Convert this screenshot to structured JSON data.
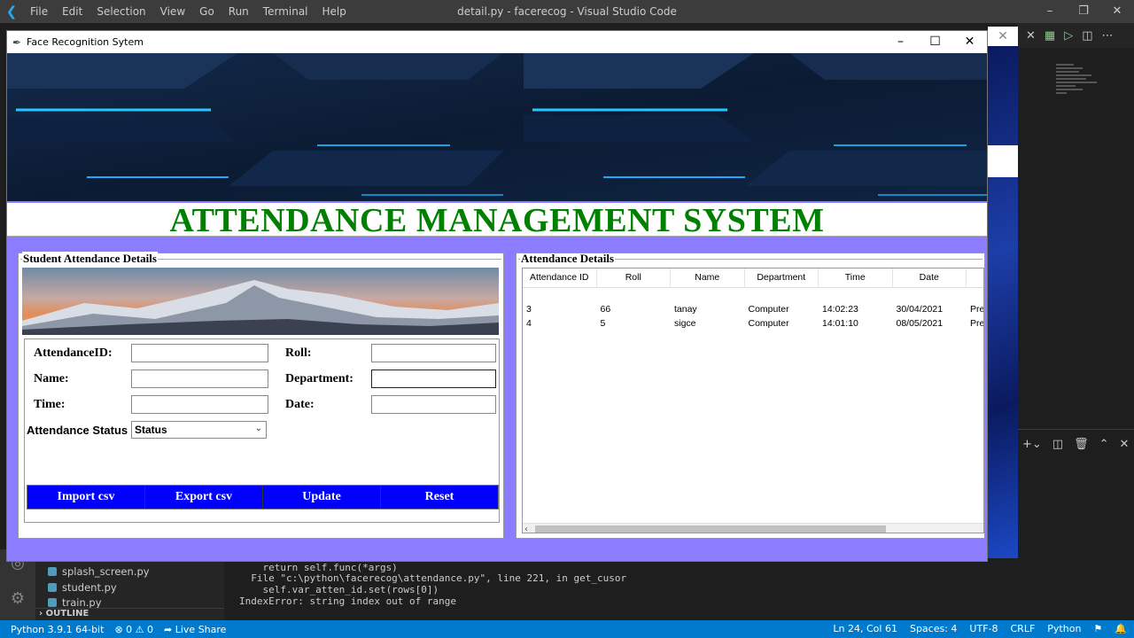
{
  "vscode": {
    "menu": [
      "File",
      "Edit",
      "Selection",
      "View",
      "Go",
      "Run",
      "Terminal",
      "Help"
    ],
    "title": "detail.py - facerecog - Visual Studio Code",
    "explorer_files": [
      "splash_screen.py",
      "student.py",
      "train.py"
    ],
    "outline_label": "OUTLINE",
    "terminal_lines": [
      "    return self.func(*args)",
      "  File \"c:\\python\\facerecog\\attendance.py\", line 221, in get_cusor",
      "    self.var_atten_id.set(rows[0])",
      "IndexError: string index out of range"
    ],
    "status_left": {
      "python": "Python 3.9.1 64-bit",
      "problems": "⊗ 0 ⚠ 0",
      "live_share": "Live Share"
    },
    "status_right": {
      "position": "Ln 24, Col 61",
      "spaces": "Spaces: 4",
      "encoding": "UTF-8",
      "eol": "CRLF",
      "language": "Python"
    }
  },
  "app": {
    "window_title": "Face Recognition Sytem",
    "main_title": "ATTENDANCE MANAGEMENT SYSTEM",
    "left_frame_label": "Student Attendance Details",
    "right_frame_label": "Attendance Details",
    "form": {
      "attendance_id_label": "AttendanceID:",
      "roll_label": "Roll:",
      "name_label": "Name:",
      "department_label": "Department:",
      "time_label": "Time:",
      "date_label": "Date:",
      "status_label": "Attendance Status",
      "status_value": "Status"
    },
    "buttons": {
      "import": "Import csv",
      "export": "Export csv",
      "update": "Update",
      "reset": "Reset"
    },
    "table": {
      "columns": [
        "Attendance ID",
        "Roll",
        "Name",
        "Department",
        "Time",
        "Date",
        "A"
      ],
      "rows": [
        [
          "3",
          "66",
          "tanay",
          "Computer",
          "14:02:23",
          "30/04/2021",
          "Pres"
        ],
        [
          "4",
          "5",
          "sigce",
          "Computer",
          "14:01:10",
          "08/05/2021",
          "Pres"
        ]
      ]
    }
  },
  "colors": {
    "app_bg": "#8c7cff",
    "title_green": "#008000",
    "button_blue": "#0000ff",
    "statusbar": "#007acc"
  }
}
